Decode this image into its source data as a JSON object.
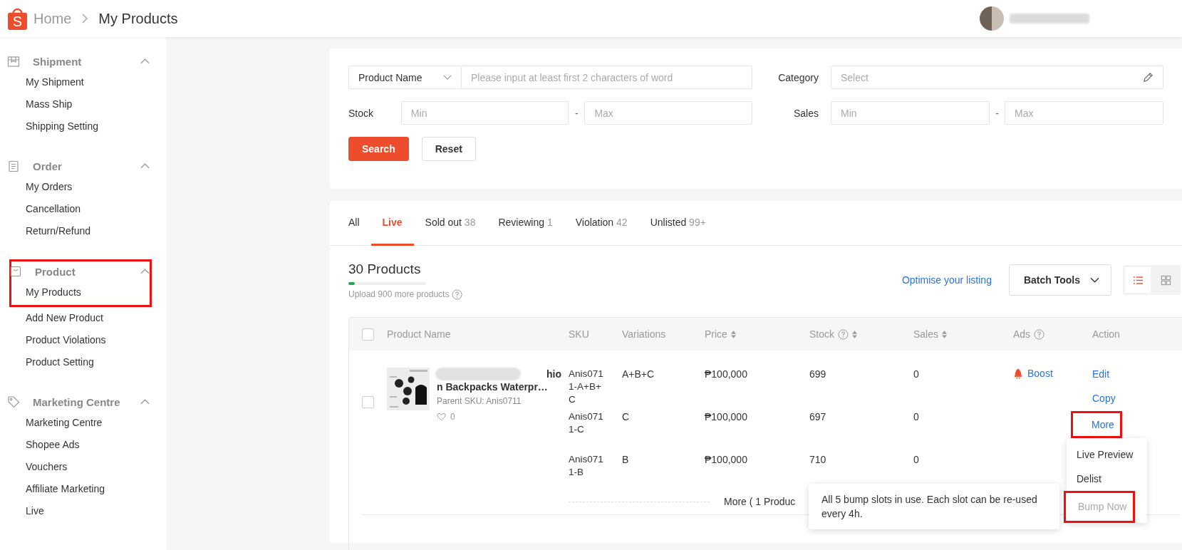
{
  "header": {
    "logo_letter": "S",
    "breadcrumb": [
      {
        "label": "Home",
        "current": false
      },
      {
        "label": "My Products",
        "current": true
      }
    ]
  },
  "sidebar": {
    "sections": [
      {
        "title": "Shipment",
        "expanded": true,
        "highlighted": false,
        "items": [
          {
            "label": "My Shipment",
            "highlighted": false
          },
          {
            "label": "Mass Ship",
            "highlighted": false
          },
          {
            "label": "Shipping Setting",
            "highlighted": false
          }
        ]
      },
      {
        "title": "Order",
        "expanded": true,
        "highlighted": false,
        "items": [
          {
            "label": "My Orders",
            "highlighted": false
          },
          {
            "label": "Cancellation",
            "highlighted": false
          },
          {
            "label": "Return/Refund",
            "highlighted": false
          }
        ]
      },
      {
        "title": "Product",
        "expanded": true,
        "highlighted": true,
        "items": [
          {
            "label": "My Products",
            "highlighted": true
          },
          {
            "label": "Add New Product",
            "highlighted": false
          },
          {
            "label": "Product Violations",
            "highlighted": false
          },
          {
            "label": "Product Setting",
            "highlighted": false
          }
        ]
      },
      {
        "title": "Marketing Centre",
        "expanded": true,
        "highlighted": false,
        "items": [
          {
            "label": "Marketing Centre",
            "highlighted": false
          },
          {
            "label": "Shopee Ads",
            "highlighted": false
          },
          {
            "label": "Vouchers",
            "highlighted": false
          },
          {
            "label": "Affiliate Marketing",
            "highlighted": false
          },
          {
            "label": "Live",
            "highlighted": false
          }
        ]
      }
    ]
  },
  "filters": {
    "name_select": "Product Name",
    "name_placeholder": "Please input at least first 2 characters of word",
    "category_label": "Category",
    "category_placeholder": "Select",
    "stock_label": "Stock",
    "stock_min_placeholder": "Min",
    "stock_separator": "-",
    "stock_max_placeholder": "Max",
    "sales_label": "Sales",
    "sales_min_placeholder": "Min",
    "sales_separator": "-",
    "sales_max_placeholder": "Max",
    "search_button": "Search",
    "reset_button": "Reset"
  },
  "tabs": [
    {
      "label": "All",
      "selected": false
    },
    {
      "label": "Live",
      "selected": true
    },
    {
      "label": "Sold out",
      "count": "38",
      "selected": false
    },
    {
      "label": "Reviewing",
      "count": "1",
      "selected": false
    },
    {
      "label": "Violation",
      "count": "42",
      "selected": false
    },
    {
      "label": "Unlisted",
      "count": "99+",
      "selected": false
    }
  ],
  "listing": {
    "title": "30 Products",
    "quota_bar": {
      "level": 0.08
    },
    "quota_text": "Upload 900 more products",
    "optimise_link": "Optimise your listing",
    "batch_tools": "Batch Tools",
    "views": [
      {
        "kind": "list",
        "selected": true
      },
      {
        "kind": "grid",
        "selected": false
      }
    ]
  },
  "table": {
    "all_checked": false,
    "columns": [
      {
        "label": "Product Name",
        "sortable": false,
        "help": false
      },
      {
        "label": "SKU",
        "sortable": false,
        "help": false
      },
      {
        "label": "Variations",
        "sortable": false,
        "help": false
      },
      {
        "label": "Price",
        "sortable": true,
        "help": false
      },
      {
        "label": "Stock",
        "sortable": true,
        "help": true
      },
      {
        "label": "Sales",
        "sortable": true,
        "help": false
      },
      {
        "label": "Ads",
        "sortable": false,
        "help": true
      },
      {
        "label": "Action",
        "sortable": false,
        "help": false
      }
    ],
    "product": {
      "checked": false,
      "name_line1": "hio",
      "name_line2": "n Backpacks Waterpr…",
      "parent_sku": "Parent SKU: Anis0711",
      "likes": "0",
      "ads": "Boost",
      "variations": [
        {
          "sku": "Anis0711-A+B+C",
          "variation": "A+B+C",
          "price": "₱100,000",
          "stock": "699",
          "sales": "0"
        },
        {
          "sku": "Anis0711-C",
          "variation": "C",
          "price": "₱100,000",
          "stock": "697",
          "sales": "0"
        },
        {
          "sku": "Anis0711-B",
          "variation": "B",
          "price": "₱100,000",
          "stock": "710",
          "sales": "0"
        }
      ],
      "actions": [
        {
          "label": "Edit",
          "highlighted": false
        },
        {
          "label": "Copy",
          "highlighted": false
        },
        {
          "label": "More",
          "highlighted": true
        }
      ],
      "more_variations": "More ( 1 Produc"
    },
    "menu": [
      {
        "label": "Live Preview",
        "disabled": false,
        "highlighted": false
      },
      {
        "label": "Delist",
        "disabled": false,
        "highlighted": false
      },
      {
        "label": "Bump Now",
        "disabled": true,
        "highlighted": true
      }
    ],
    "tooltip": "All 5 bump slots in use. Each slot can be re-used every 4h."
  }
}
